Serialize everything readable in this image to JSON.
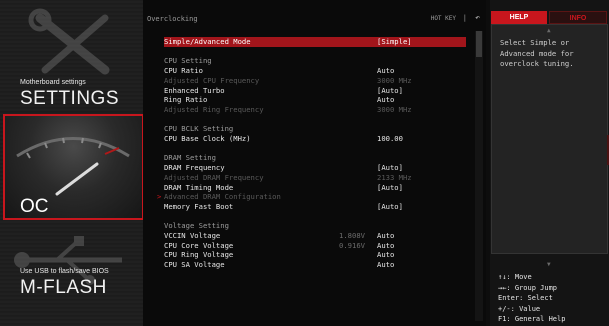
{
  "sidebar": {
    "settings": {
      "small": "Motherboard settings",
      "big": "SETTINGS"
    },
    "oc": {
      "big": "OC"
    },
    "mflash": {
      "small": "Use USB to flash/save BIOS",
      "big": "M-FLASH"
    }
  },
  "main": {
    "title": "Overclocking",
    "hotkey": "HOT KEY",
    "hotkey_sep": "|",
    "back_icon": "back-arrow-icon",
    "rows": [
      {
        "label": "Simple/Advanced Mode",
        "pre": "",
        "value": "[Simple]",
        "style": "highlight"
      },
      {
        "label": "",
        "pre": "",
        "value": "",
        "style": "spacer"
      },
      {
        "label": "CPU Setting",
        "pre": "",
        "value": "",
        "style": "head"
      },
      {
        "label": "CPU Ratio",
        "pre": "",
        "value": "Auto",
        "style": "normal"
      },
      {
        "label": "Adjusted CPU Frequency",
        "pre": "",
        "value": "3000 MHz",
        "style": "dim"
      },
      {
        "label": "Enhanced Turbo",
        "pre": "",
        "value": "[Auto]",
        "style": "normal"
      },
      {
        "label": "Ring Ratio",
        "pre": "",
        "value": "Auto",
        "style": "normal"
      },
      {
        "label": "Adjusted Ring Frequency",
        "pre": "",
        "value": "3000 MHz",
        "style": "dim"
      },
      {
        "label": "",
        "pre": "",
        "value": "",
        "style": "spacer"
      },
      {
        "label": "CPU BCLK Setting",
        "pre": "",
        "value": "",
        "style": "head"
      },
      {
        "label": "CPU Base Clock (MHz)",
        "pre": "",
        "value": "100.00",
        "style": "normal"
      },
      {
        "label": "",
        "pre": "",
        "value": "",
        "style": "spacer"
      },
      {
        "label": "DRAM Setting",
        "pre": "",
        "value": "",
        "style": "head"
      },
      {
        "label": "DRAM Frequency",
        "pre": "",
        "value": "[Auto]",
        "style": "normal"
      },
      {
        "label": "Adjusted DRAM Frequency",
        "pre": "",
        "value": "2133 MHz",
        "style": "dim"
      },
      {
        "label": "DRAM Timing Mode",
        "pre": "",
        "value": "[Auto]",
        "style": "normal"
      },
      {
        "label": "Advanced DRAM Configuration",
        "pre": "",
        "value": "",
        "style": "dim",
        "submenu": true
      },
      {
        "label": "Memory Fast Boot",
        "pre": "",
        "value": "[Auto]",
        "style": "normal"
      },
      {
        "label": "",
        "pre": "",
        "value": "",
        "style": "spacer"
      },
      {
        "label": "Voltage Setting",
        "pre": "",
        "value": "",
        "style": "head"
      },
      {
        "label": "VCCIN Voltage",
        "pre": "1.808V",
        "value": "Auto",
        "style": "normal"
      },
      {
        "label": "CPU Core Voltage",
        "pre": "0.916V",
        "value": "Auto",
        "style": "normal"
      },
      {
        "label": "CPU Ring Voltage",
        "pre": "",
        "value": "Auto",
        "style": "normal"
      },
      {
        "label": "CPU SA Voltage",
        "pre": "",
        "value": "Auto",
        "style": "normal"
      }
    ],
    "submenu_marker": ">"
  },
  "help": {
    "tab_help": "HELP",
    "tab_info": "INFO",
    "text": "Select Simple or Advanced mode for overclock tuning.",
    "keys": [
      "↑↓: Move",
      "→←: Group Jump",
      "Enter: Select",
      "+/-: Value",
      "F1: General Help"
    ]
  },
  "colors": {
    "accent": "#c8161d",
    "highlight": "#a2151b"
  }
}
